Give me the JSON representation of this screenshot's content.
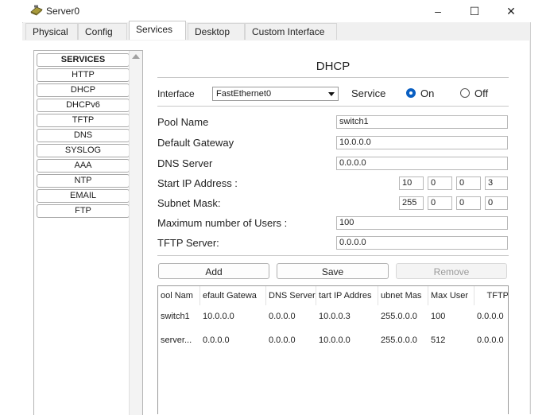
{
  "window": {
    "title": "Server0",
    "controls": {
      "minimize": "–",
      "maximize": "☐",
      "close": "✕"
    }
  },
  "tabs": [
    {
      "label": "Physical",
      "active": false
    },
    {
      "label": "Config",
      "active": false
    },
    {
      "label": "Services",
      "active": true
    },
    {
      "label": "Desktop",
      "active": false
    },
    {
      "label": "Custom Interface",
      "active": false
    }
  ],
  "services": {
    "header": "SERVICES",
    "items": [
      "HTTP",
      "DHCP",
      "DHCPv6",
      "TFTP",
      "DNS",
      "SYSLOG",
      "AAA",
      "NTP",
      "EMAIL",
      "FTP"
    ]
  },
  "dhcp": {
    "title": "DHCP",
    "interface_label": "Interface",
    "interface_value": "FastEthernet0",
    "service_label": "Service",
    "on_label": "On",
    "off_label": "Off",
    "service_state": "On",
    "pool_name_label": "Pool Name",
    "pool_name_value": "switch1",
    "gateway_label": "Default Gateway",
    "gateway_value": "10.0.0.0",
    "dns_label": "DNS Server",
    "dns_value": "0.0.0.0",
    "start_ip_label": "Start IP Address :",
    "start_ip": [
      "10",
      "0",
      "0",
      "3"
    ],
    "subnet_label": "Subnet Mask:",
    "subnet": [
      "255",
      "0",
      "0",
      "0"
    ],
    "max_users_label": "Maximum number of Users :",
    "max_users_value": "100",
    "tftp_label": "TFTP Server:",
    "tftp_value": "0.0.0.0",
    "buttons": {
      "add": "Add",
      "save": "Save",
      "remove": "Remove"
    }
  },
  "table": {
    "headers": [
      "ool Nam",
      "efault Gatewa",
      "DNS Server",
      "tart IP Addres",
      "ubnet Mas",
      "Max User",
      "TFTP"
    ],
    "rows": [
      [
        "switch1",
        "10.0.0.0",
        "0.0.0.0",
        "10.0.0.3",
        "255.0.0.0",
        "100",
        "0.0.0.0"
      ],
      [
        "server...",
        "0.0.0.0",
        "0.0.0.0",
        "10.0.0.0",
        "255.0.0.0",
        "512",
        "0.0.0.0"
      ]
    ]
  },
  "colors": {
    "accent": "#0a5fc2",
    "border": "#b4b4b4",
    "background": "#f0f0f0"
  }
}
